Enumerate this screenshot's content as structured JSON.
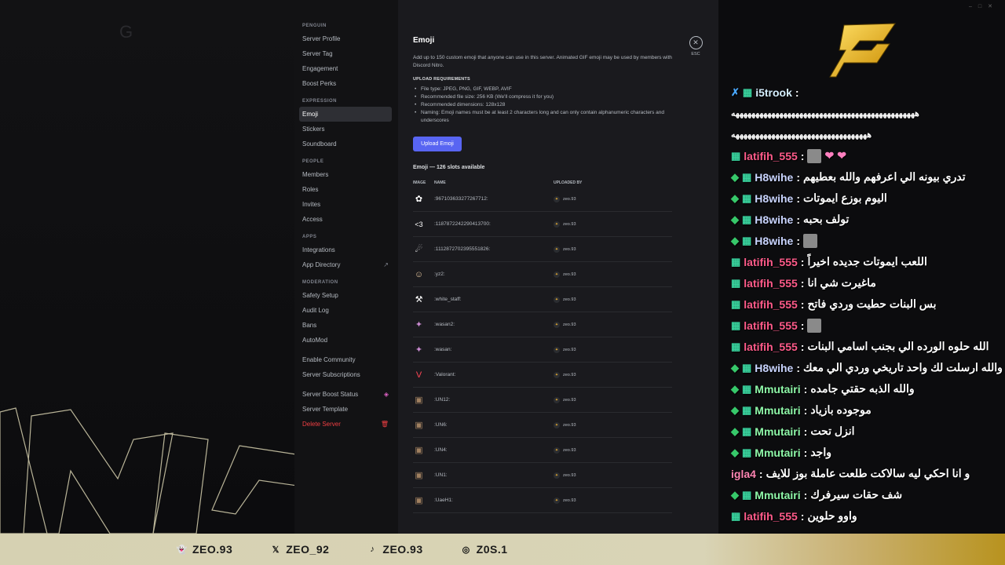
{
  "sidebar": {
    "sections": [
      {
        "header": "PENGUIN",
        "items": [
          "Server Profile",
          "Server Tag",
          "Engagement",
          "Boost Perks"
        ]
      },
      {
        "header": "EXPRESSION",
        "items": [
          "Emoji",
          "Stickers",
          "Soundboard"
        ]
      },
      {
        "header": "PEOPLE",
        "items": [
          "Members",
          "Roles",
          "Invites",
          "Access"
        ]
      },
      {
        "header": "APPS",
        "items": [
          "Integrations",
          "App Directory"
        ]
      },
      {
        "header": "MODERATION",
        "items": [
          "Safety Setup",
          "Audit Log",
          "Bans",
          "AutoMod"
        ]
      },
      {
        "header": "",
        "items": [
          "Enable Community",
          "Server Subscriptions"
        ]
      },
      {
        "header": "",
        "items": [
          "Server Boost Status",
          "Server Template",
          "Delete Server"
        ]
      }
    ],
    "active_item": "Emoji"
  },
  "main": {
    "title": "Emoji",
    "description": "Add up to 150 custom emoji that anyone can use in this server. Animated GIF emoji may be used by members with Discord Nitro.",
    "requirements_header": "UPLOAD REQUIREMENTS",
    "requirements": [
      "File type: JPEG, PNG, GIF, WEBP, AVIF",
      "Recommended file size: 256 KB (We'll compress it for you)",
      "Recommended dimensions: 128x128",
      "Naming: Emoji names must be at least 2 characters long and can only contain alphanumeric characters and underscores"
    ],
    "upload_button": "Upload Emoji",
    "slots_label": "Emoji — 126 slots available",
    "columns": {
      "image": "IMAGE",
      "name": "NAME",
      "uploaded_by": "UPLOADED BY"
    },
    "close_label": "ESC",
    "emoji_rows": [
      {
        "name": ":967103633277267712:",
        "uploader": "zeo.93",
        "icon": "snowflake-icon"
      },
      {
        "name": ":1187872242290413700:",
        "uploader": "zeo.93",
        "icon": "less-than-three-icon"
      },
      {
        "name": ":1112872702395551826:",
        "uploader": "zeo.93",
        "icon": "planet-icon"
      },
      {
        "name": ":yz2:",
        "uploader": "zeo.93",
        "icon": "face-icon"
      },
      {
        "name": ":white_staff:",
        "uploader": "zeo.93",
        "icon": "tools-icon"
      },
      {
        "name": ":wasan2:",
        "uploader": "zeo.93",
        "icon": "character-icon"
      },
      {
        "name": ":wasan:",
        "uploader": "zeo.93",
        "icon": "character-icon"
      },
      {
        "name": ":Valorant:",
        "uploader": "zeo.93",
        "icon": "valorant-icon"
      },
      {
        "name": ":UN12:",
        "uploader": "zeo.93",
        "icon": "photo-icon"
      },
      {
        "name": ":UN6:",
        "uploader": "zeo.93",
        "icon": "photo-icon"
      },
      {
        "name": ":UN4:",
        "uploader": "zeo.93",
        "icon": "photo-icon"
      },
      {
        "name": ":UN1:",
        "uploader": "zeo.93",
        "icon": "photo-icon"
      },
      {
        "name": ":UaeH1:",
        "uploader": "zeo.93",
        "icon": "photo-icon"
      }
    ]
  },
  "chat": {
    "messages": [
      {
        "user": "i5trook",
        "text": "",
        "style": "i5"
      },
      {
        "user": "",
        "text": "ههههههههههههههههههههههههههههههههههههههههههههههه",
        "style": "plain"
      },
      {
        "user": "",
        "text": "ههههههههههههههههههههههههههههههههههه",
        "style": "plain"
      },
      {
        "user": "latifih_555",
        "text": "",
        "style": "lat",
        "emotes": true
      },
      {
        "user": "H8wihe",
        "text": "تدري بيونه الي اعرفهم والله بعطيهم",
        "style": "h8"
      },
      {
        "user": "H8wihe",
        "text": "اليوم بوزع ايموتات",
        "style": "h8"
      },
      {
        "user": "H8wihe",
        "text": "تولف بحبه",
        "style": "h8"
      },
      {
        "user": "H8wihe",
        "text": "",
        "style": "h8",
        "emotes": true
      },
      {
        "user": "latifih_555",
        "text": "اللعب ايموتات جديده اخيراً",
        "style": "lat"
      },
      {
        "user": "latifih_555",
        "text": "ماغيرت شي انا",
        "style": "lat"
      },
      {
        "user": "latifih_555",
        "text": "بس البنات حطيت وردي فاتح",
        "style": "lat"
      },
      {
        "user": "latifih_555",
        "text": "",
        "style": "lat",
        "emotes": true
      },
      {
        "user": "latifih_555",
        "text": "الله حلوه الورده الي بجنب اسامي البنات",
        "style": "lat"
      },
      {
        "user": "H8wihe",
        "text": "والله ارسلت لك واحد تاريخي وردي الي معك",
        "style": "h8"
      },
      {
        "user": "Mmutairi",
        "text": "والله الذبه حقتي جامده",
        "style": "mm"
      },
      {
        "user": "Mmutairi",
        "text": "موجوده بازياد",
        "style": "mm"
      },
      {
        "user": "Mmutairi",
        "text": "انزل تحت",
        "style": "mm"
      },
      {
        "user": "Mmutairi",
        "text": "واجد",
        "style": "mm"
      },
      {
        "user": "igla4",
        "text": "و انا احكي ليه سالاكت طلعت عاملة بوز للايف",
        "style": "ig"
      },
      {
        "user": "Mmutairi",
        "text": "شف حقات سيرفرك",
        "style": "mm"
      },
      {
        "user": "latifih_555",
        "text": "واوو حلوين",
        "style": "lat"
      }
    ]
  },
  "socials": [
    {
      "icon": "snapchat-icon",
      "handle": "ZEO.93"
    },
    {
      "icon": "x-icon",
      "handle": "ZEO_92"
    },
    {
      "icon": "tiktok-icon",
      "handle": "ZEO.93"
    },
    {
      "icon": "instagram-icon",
      "handle": "Z0S.1"
    }
  ],
  "colors": {
    "accent": "#5865f2",
    "danger": "#f23f43",
    "bar_gold": "#b8931f"
  }
}
